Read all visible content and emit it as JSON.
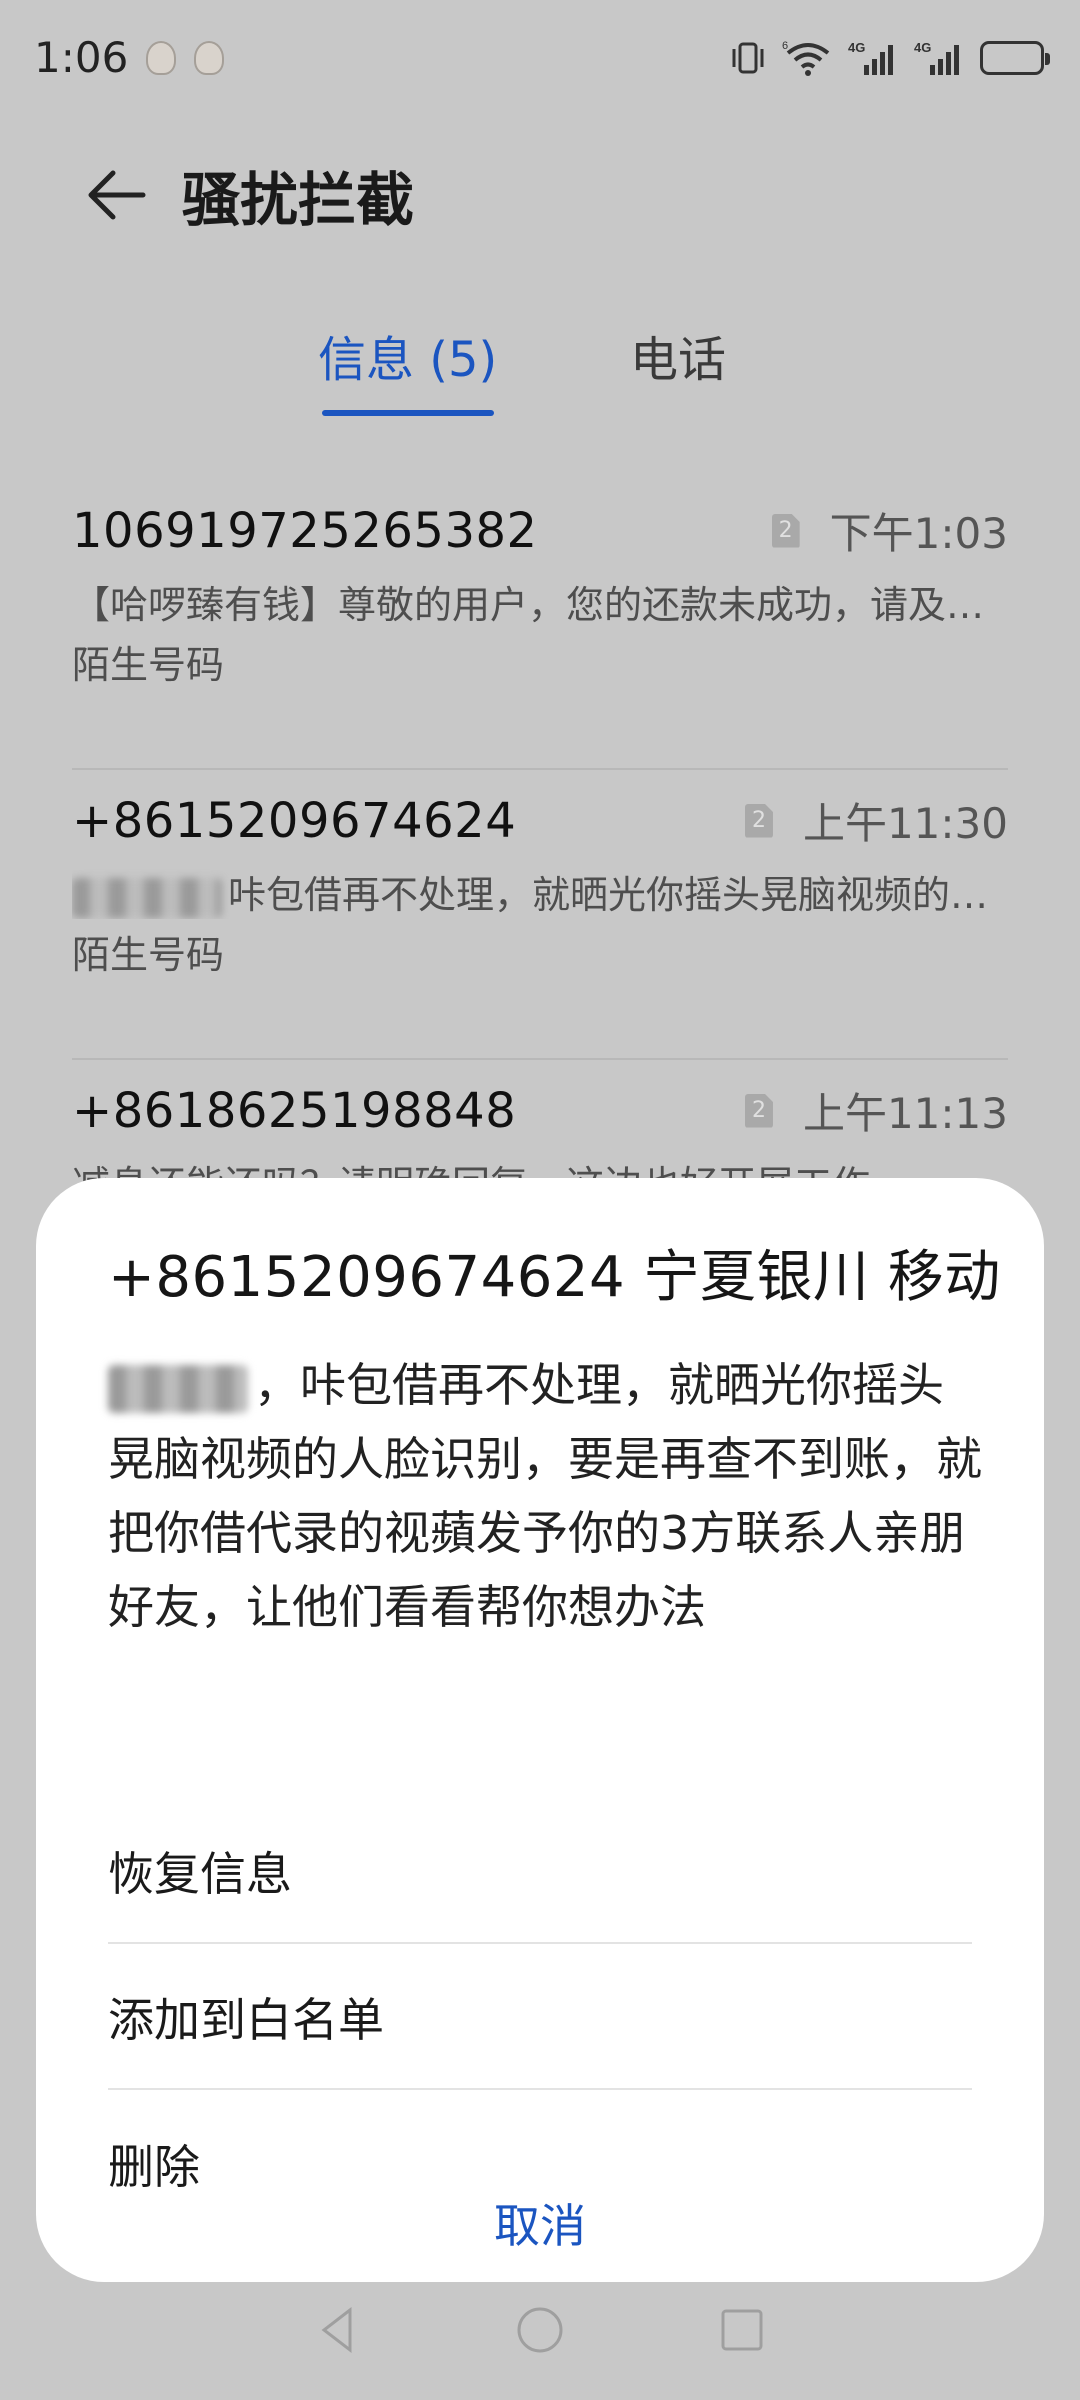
{
  "status_bar": {
    "time": "1:06",
    "icons": [
      "notification-avatar-icon",
      "notification-avatar-icon",
      "vibrate-icon",
      "wifi-icon",
      "signal-4g-icon",
      "signal-4g-icon",
      "battery-icon"
    ],
    "network_label_1": "4G",
    "network_label_2": "4G",
    "wifi_badge": "6"
  },
  "header": {
    "title": "骚扰拦截"
  },
  "tabs": [
    {
      "label": "信息 (5)",
      "active": true
    },
    {
      "label": "电话",
      "active": false
    }
  ],
  "messages": [
    {
      "number": "106919725265382",
      "sim": "2",
      "time": "下午1:03",
      "preview": "【哈啰臻有钱】尊敬的用户，您的还款未成功，请及时处理",
      "tag": "陌生号码"
    },
    {
      "number": "+8615209674624",
      "sim": "2",
      "time": "上午11:30",
      "preview": "咔包借再不处理，就晒光你摇头晃脑视频的人脸识别",
      "tag": "陌生号码"
    },
    {
      "number": "+8618625198848",
      "sim": "2",
      "time": "上午11:13",
      "preview": "减息还能还吗？请明确回复，这边也好开展工作",
      "tag": ""
    }
  ],
  "sheet": {
    "title": "+8615209674624 宁夏银川 移动",
    "body": "，咔包借再不处理，就晒光你摇头晃脑视频的人脸识别，要是再查不到账，就把你借代录的视蘋发予你的3方联系人亲朋好友，让他们看看帮你想办法",
    "actions": {
      "restore": "恢复信息",
      "whitelist": "添加到白名单",
      "delete": "删除"
    },
    "cancel": "取消"
  },
  "colors": {
    "accent": "#1b55c0",
    "scrim_bg": "#c8c8c8",
    "sheet_bg": "#ffffff"
  }
}
